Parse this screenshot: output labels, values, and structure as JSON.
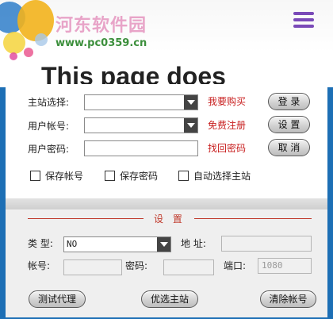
{
  "brand": {
    "site_name": "河东软件园",
    "url": "www.pc0359.cn",
    "banner_text": "This page does"
  },
  "login": {
    "main_site_label": "主站选择:",
    "account_label": "用户帐号:",
    "password_label": "用户密码:",
    "buy_link": "我要购买",
    "register_link": "免费注册",
    "recover_link": "找回密码",
    "login_button": "登 录",
    "settings_button": "设 置",
    "cancel_button": "取 消",
    "remember_account": "保存帐号",
    "remember_password": "保存密码",
    "auto_select_site": "自动选择主站"
  },
  "settings": {
    "title": "设 置",
    "type_label": "类 型:",
    "type_value": "NO",
    "address_label": "地 址:",
    "account_label": "帐号:",
    "password_label": "密码:",
    "port_label": "端口:",
    "port_value": "1080",
    "test_proxy_button": "测试代理",
    "pick_site_button": "优选主站",
    "clear_account_button": "清除帐号"
  },
  "colors": {
    "link_red": "#c81e1e",
    "desktop_blue": "#1d6fb5",
    "menu_purple": "#7a4ab8"
  },
  "icons": [
    "hamburger-menu-icon",
    "dropdown-arrow-icon"
  ]
}
